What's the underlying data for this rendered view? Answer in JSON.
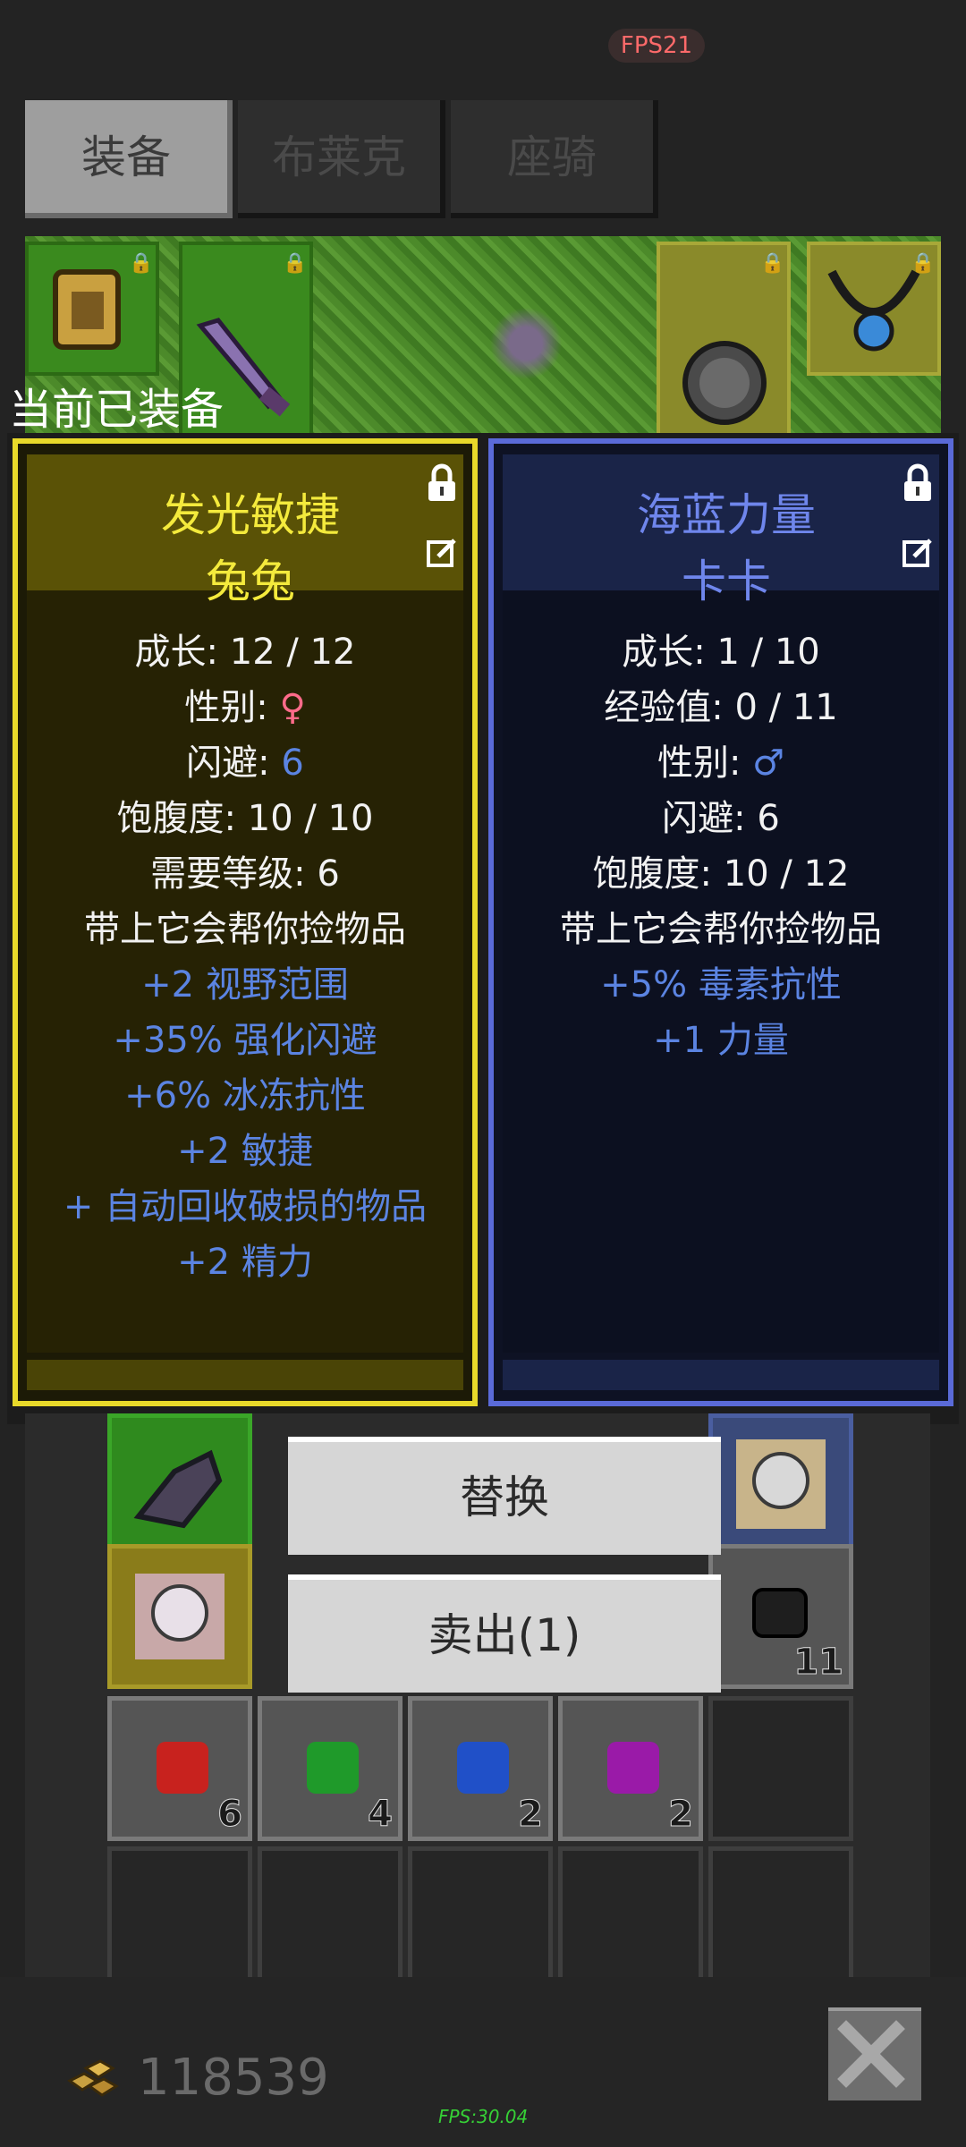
{
  "fps_top": "FPS21",
  "tabs": [
    "装备",
    "布莱克",
    "座骑"
  ],
  "equipped_label": "当前已装备",
  "left_card": {
    "title": "发光敏捷",
    "name": "兔兔",
    "stats": [
      {
        "label": "成长: ",
        "value": "12 / 12",
        "style": "normal"
      },
      {
        "label": "性别: ",
        "value": "♀",
        "style": "pink"
      },
      {
        "label": "闪避: ",
        "value": "6",
        "style": "bluev"
      },
      {
        "label": "饱腹度: ",
        "value": "10 / 10",
        "style": "normal"
      },
      {
        "label": "需要等级: ",
        "value": "6",
        "style": "normal"
      },
      {
        "label": "带上它会帮你捡物品",
        "value": "",
        "style": "normal"
      }
    ],
    "bonuses": [
      "+2 视野范围",
      "+35% 强化闪避",
      "+6% 冰冻抗性",
      "+2 敏捷",
      "+ 自动回收破损的物品",
      "+2 精力"
    ]
  },
  "right_card": {
    "title": "海蓝力量",
    "name": "卡卡",
    "stats": [
      {
        "label": "成长: ",
        "value": "1 / 10",
        "style": "normal"
      },
      {
        "label": "经验值: ",
        "value": "0 / 11",
        "style": "normal"
      },
      {
        "label": "性别: ",
        "value": "♂",
        "style": "bluev"
      },
      {
        "label": "闪避: ",
        "value": "6",
        "style": "normal"
      },
      {
        "label": "饱腹度: ",
        "value": "10 / 12",
        "style": "normal"
      },
      {
        "label": "带上它会帮你捡物品",
        "value": "",
        "style": "normal"
      }
    ],
    "bonuses": [
      "+5% 毒素抗性",
      "+1 力量"
    ]
  },
  "actions": {
    "replace": "替换",
    "sell": "卖出(1)"
  },
  "inventory": {
    "stack_count": "11",
    "gems": [
      {
        "color": "#c8221e",
        "count": "6"
      },
      {
        "color": "#1f9a2a",
        "count": "4"
      },
      {
        "color": "#2050c8",
        "count": "2"
      },
      {
        "color": "#9a1aa8",
        "count": "2"
      }
    ]
  },
  "gold": "118539",
  "fps_bottom": "FPS:30.04"
}
